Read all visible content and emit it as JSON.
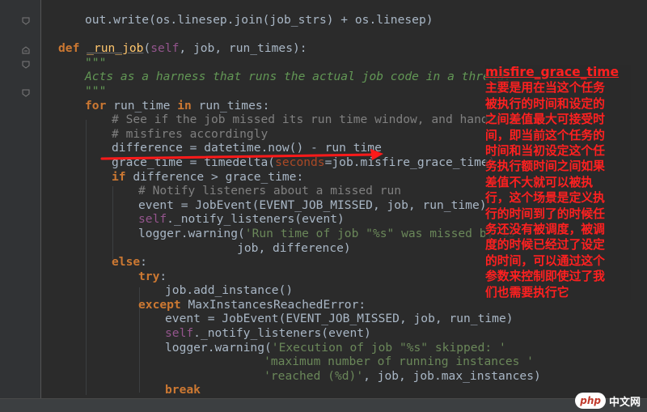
{
  "editor": {
    "lines": [
      {
        "segs": [
          [
            "",
            "out.write(os.linesep.join(job_strs) + os.linesep)"
          ]
        ],
        "indent": 1
      },
      {
        "segs": [],
        "indent": 0
      },
      {
        "segs": [
          [
            "kw",
            "def "
          ],
          [
            "fname",
            "_run_job"
          ],
          [
            "",
            "("
          ],
          [
            "self",
            "self"
          ],
          [
            "",
            ", job, run_times):"
          ]
        ],
        "indent": 0
      },
      {
        "segs": [
          [
            "doc",
            "\"\"\""
          ]
        ],
        "indent": 1
      },
      {
        "segs": [
          [
            "doc",
            "Acts as a harness that runs the actual job code in a thread."
          ]
        ],
        "indent": 1
      },
      {
        "segs": [
          [
            "doc",
            "\"\"\""
          ]
        ],
        "indent": 1
      },
      {
        "segs": [
          [
            "kw",
            "for "
          ],
          [
            "",
            "run_time "
          ],
          [
            "kw",
            "in "
          ],
          [
            "",
            "run_times:"
          ]
        ],
        "indent": 1
      },
      {
        "segs": [
          [
            "cmt",
            "# See if the job missed its run time window, and handle p"
          ]
        ],
        "indent": 2
      },
      {
        "segs": [
          [
            "cmt",
            "# misfires accordingly"
          ]
        ],
        "indent": 2
      },
      {
        "segs": [
          [
            "",
            "difference = datetime.now() - run_time"
          ]
        ],
        "indent": 2
      },
      {
        "segs": [
          [
            "",
            "grace_time = timedelta("
          ],
          [
            "arg",
            "seconds"
          ],
          [
            "",
            "=job.misfire_grace_time)"
          ]
        ],
        "indent": 2
      },
      {
        "segs": [
          [
            "kw",
            "if "
          ],
          [
            "",
            "difference > grace_time:"
          ]
        ],
        "indent": 2
      },
      {
        "segs": [
          [
            "cmt",
            "# Notify listeners about a missed run"
          ]
        ],
        "indent": 3
      },
      {
        "segs": [
          [
            "",
            "event = JobEvent(EVENT_JOB_MISSED, job, run_time)"
          ]
        ],
        "indent": 3
      },
      {
        "segs": [
          [
            "self",
            "self"
          ],
          [
            "",
            "._notify_listeners(event)"
          ]
        ],
        "indent": 3
      },
      {
        "segs": [
          [
            "",
            "logger.warning("
          ],
          [
            "str",
            "'Run time of job \"%s\" was missed by %s"
          ]
        ],
        "indent": 3
      },
      {
        "segs": [
          [
            "",
            "job, difference)"
          ]
        ],
        "indent": 6.7
      },
      {
        "segs": [
          [
            "kw",
            "else"
          ],
          [
            "",
            ":"
          ]
        ],
        "indent": 2
      },
      {
        "segs": [
          [
            "kw",
            "try"
          ],
          [
            "",
            ":"
          ]
        ],
        "indent": 3
      },
      {
        "segs": [
          [
            "",
            "job.add_instance()"
          ]
        ],
        "indent": 4
      },
      {
        "segs": [
          [
            "kw",
            "except "
          ],
          [
            "",
            "MaxInstancesReachedError:"
          ]
        ],
        "indent": 3
      },
      {
        "segs": [
          [
            "",
            "event = JobEvent(EVENT_JOB_MISSED, job, run_time)"
          ]
        ],
        "indent": 4
      },
      {
        "segs": [
          [
            "self",
            "self"
          ],
          [
            "",
            "._notify_listeners(event)"
          ]
        ],
        "indent": 4
      },
      {
        "segs": [
          [
            "",
            "logger.warning("
          ],
          [
            "str",
            "'Execution of job \"%s\" skipped: '"
          ]
        ],
        "indent": 4
      },
      {
        "segs": [
          [
            "str",
            "'maximum number of running instances '"
          ]
        ],
        "indent": 7.7
      },
      {
        "segs": [
          [
            "str",
            "'reached (%d)'"
          ],
          [
            "",
            ", job, job.max_instances)"
          ]
        ],
        "indent": 7.7
      },
      {
        "segs": [
          [
            "kw",
            "break"
          ]
        ],
        "indent": 4
      }
    ]
  },
  "annotation": {
    "title": "misfire_grace_time",
    "body_lines": [
      "主要是用在当这个任务",
      "被执行的时间和设定的",
      "之间差值最大可接受时",
      "间，即当前这个任务的",
      "时间和当初设定这个任",
      "务执行额时间之间如果",
      "差值不大就可以被执",
      "行，这个场景是定义执",
      "行的时间到了的时候任",
      "务还没有被调度，被调",
      "度的时候已经过了设定",
      "的时间，可以通过这个",
      "参数来控制即使过了我",
      "们也需要执行它"
    ],
    "color": "#ff2020"
  },
  "watermark": {
    "logo": "php",
    "text": "中文网"
  }
}
